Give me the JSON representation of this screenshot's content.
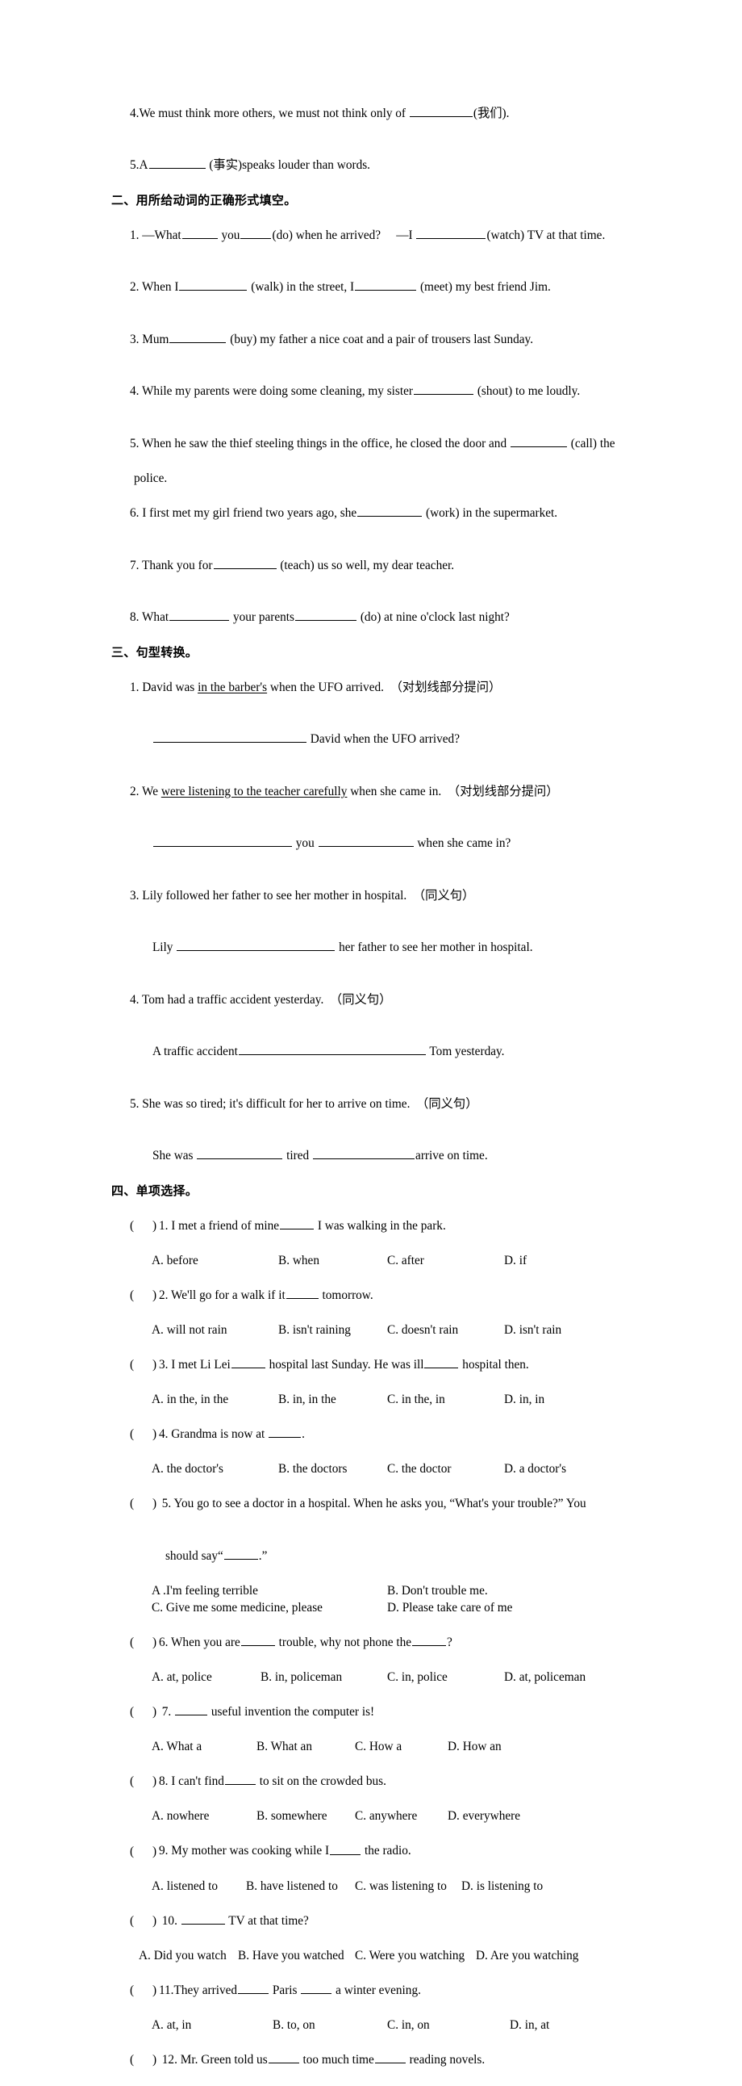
{
  "document": {
    "type": "english-grammar-worksheet",
    "language": "en-zh"
  },
  "section_one_tail": {
    "item4": {
      "num": "4.",
      "text_before": "We must think more others, we must not think only of ",
      "text_after": "(我们)."
    },
    "item5": {
      "num": "5.",
      "text_before": "A",
      "text_after": " (事实)speaks louder than words."
    }
  },
  "section_two": {
    "heading": "二、用所给动词的正确形式填空。",
    "items": [
      {
        "num": "1.",
        "p1": " —What",
        "p2": " you",
        "p3": "(do) when he arrived?     —I ",
        "p4": "(watch) TV at that time."
      },
      {
        "num": "2.",
        "p1": " When I",
        "p2": " (walk) in the street, I",
        "p3": " (meet) my best friend Jim."
      },
      {
        "num": "3.",
        "p1": " Mum",
        "p2": " (buy) my father a nice coat and a pair of trousers last Sunday."
      },
      {
        "num": "4.",
        "p1": " While my parents were doing some cleaning, my sister",
        "p2": " (shout) to me loudly."
      },
      {
        "num": "5.",
        "p1": " When he saw the thief steeling things in the office, he closed the door and ",
        "p2": " (call) the",
        "cont": "police."
      },
      {
        "num": "6.",
        "p1": " I first met my girl friend two years ago, she",
        "p2": " (work) in the supermarket."
      },
      {
        "num": "7.",
        "p1": " Thank you for",
        "p2": " (teach) us so well, my dear teacher."
      },
      {
        "num": "8.",
        "p1": " What",
        "p2": " your parents",
        "p3": " (do) at nine o'clock last night?"
      }
    ]
  },
  "section_three": {
    "heading": "三、句型转换。",
    "items": [
      {
        "num": "1.",
        "q_pre": " David was ",
        "q_underlined": "in the barber's",
        "q_post": " when the UFO arrived.  （对划线部分提问）",
        "a_pre": "",
        "a_post": " David when the UFO arrived?"
      },
      {
        "num": "2.",
        "q_pre": " We ",
        "q_underlined": "were listening to the teacher carefully",
        "q_post": " when she came in.  （对划线部分提问）",
        "a_mid": " you ",
        "a_post": " when she came in?"
      },
      {
        "num": "3.",
        "q": " Lily followed her father to see her mother in hospital.  （同义句）",
        "a_pre": "Lily ",
        "a_post": " her father to see her mother in hospital."
      },
      {
        "num": "4.",
        "q": " Tom had a traffic accident yesterday.  （同义句）",
        "a_pre": "A traffic accident",
        "a_post": " Tom yesterday."
      },
      {
        "num": "5.",
        "q": " She was so tired; it's difficult for her to arrive on time.  （同义句）",
        "a_pre": "She was ",
        "a_mid": " tired ",
        "a_post": "arrive on time."
      }
    ]
  },
  "section_four": {
    "heading": "四、单项选择。",
    "paren": "(      )",
    "items": [
      {
        "num": "1.",
        "stem_a": " I met a friend of mine",
        "stem_b": " I was walking in the park.",
        "layout": "cols4",
        "cols": [
          188,
          345,
          480,
          625
        ],
        "options": [
          "A. before",
          "B. when",
          "C. after",
          "D. if"
        ]
      },
      {
        "num": "2.",
        "stem_a": " We'll go for a walk if it",
        "stem_b": " tomorrow.",
        "layout": "cols4",
        "cols": [
          188,
          345,
          480,
          625
        ],
        "options": [
          "A. will not rain",
          "B. isn't raining",
          "C. doesn't rain",
          "D. isn't rain"
        ]
      },
      {
        "num": "3.",
        "stem_a": " I met Li Lei",
        "stem_b": " hospital last Sunday. He was ill",
        "stem_c": " hospital then.",
        "layout": "cols4",
        "cols": [
          188,
          345,
          480,
          625
        ],
        "options": [
          "A. in the, in the",
          "B. in, in the",
          "C. in the, in",
          "D. in, in"
        ]
      },
      {
        "num": "4.",
        "stem_a": " Grandma is now at ",
        "stem_b": ".",
        "layout": "cols4",
        "cols": [
          188,
          345,
          480,
          625
        ],
        "options": [
          "A. the doctor's",
          "B. the doctors",
          "C. the doctor",
          "D. a doctor's"
        ]
      },
      {
        "num": " 5.",
        "stem_a": " You go to see a doctor in a hospital. When he asks you, “What's your trouble?” You",
        "cont_a": "should say“",
        "cont_b": ".”",
        "layout": "cols2",
        "cols": [
          188,
          480
        ],
        "options": [
          "A .I'm feeling terrible",
          "B. Don't trouble me.",
          "C. Give me some medicine, please",
          "D. Please take care of me"
        ]
      },
      {
        "num": "6.",
        "stem_a": " When you are",
        "stem_b": " trouble, why not phone the",
        "stem_c": "?",
        "layout": "cols4",
        "cols": [
          188,
          345,
          480,
          625
        ],
        "options": [
          "A. at, police",
          "B. in, policeman",
          "C. in, police",
          "D. at, policeman"
        ]
      },
      {
        "num": " 7.",
        "stem_a": " ",
        "stem_b": " useful invention the computer is!",
        "layout": "cols4",
        "cols": [
          188,
          318,
          440,
          555
        ],
        "options": [
          "A. What a",
          "B. What an",
          "C. How a",
          "D. How an"
        ]
      },
      {
        "num": "8.",
        "stem_a": " I can't find",
        "stem_b": " to sit on the crowded bus.",
        "layout": "cols4",
        "cols": [
          188,
          318,
          440,
          555
        ],
        "options": [
          "A. nowhere",
          "B. somewhere",
          "C. anywhere",
          "D. everywhere"
        ]
      },
      {
        "num": "9.",
        "stem_a": " My mother was cooking while I",
        "stem_b": " the radio.",
        "layout": "cols4",
        "cols": [
          188,
          305,
          440,
          572
        ],
        "options": [
          "A. listened to",
          "B. have listened to",
          "C. was listening to",
          "D. is listening to"
        ]
      },
      {
        "num": " 10.",
        "stem_a": " ",
        "stem_b": " TV at that time?",
        "layout": "cols4",
        "cols": [
          172,
          295,
          440,
          590
        ],
        "options": [
          "A. Did you watch",
          "B. Have you watched",
          "C. Were you watching",
          "D. Are you watching"
        ]
      },
      {
        "num": "11.",
        "stem_a": "They arrived",
        "stem_b": " Paris ",
        "stem_c": " a winter evening.",
        "layout": "cols4",
        "cols": [
          188,
          338,
          480,
          632
        ],
        "options": [
          "A. at, in",
          "B. to, on",
          "C. in, on",
          "D. in, at"
        ]
      },
      {
        "num": " 12.",
        "stem_a": " Mr. Green told us",
        "stem_b": " too much time",
        "stem_c": " reading novels.",
        "layout": "none",
        "cols": [],
        "options": []
      }
    ]
  }
}
